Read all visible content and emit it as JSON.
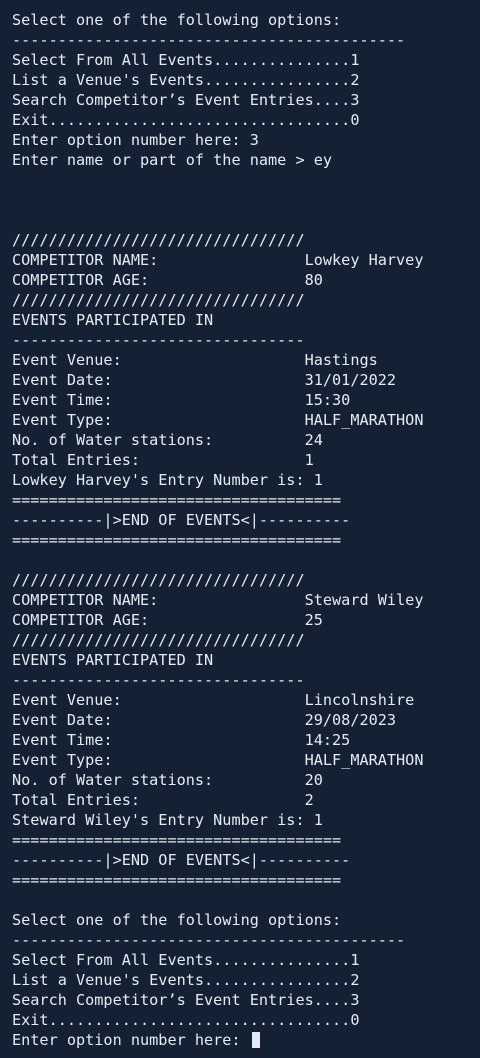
{
  "terminal": {
    "background": "#142033",
    "foreground": "#e6ebf2",
    "lines": [
      "Select one of the following options:",
      "-------------------------------------------",
      "Select From All Events...............1",
      "List a Venue's Events................2",
      "Search Competitor’s Event Entries....3",
      "Exit.................................0",
      "Enter option number here: 3",
      "Enter name or part of the name > ey",
      "",
      "",
      "",
      "////////////////////////////////",
      "COMPETITOR NAME:                Lowkey Harvey",
      "COMPETITOR AGE:                 80",
      "////////////////////////////////",
      "EVENTS PARTICIPATED IN",
      "--------------------------------",
      "Event Venue:                    Hastings",
      "Event Date:                     31/01/2022",
      "Event Time:                     15:30",
      "Event Type:                     HALF_MARATHON",
      "No. of Water stations:          24",
      "Total Entries:                  1",
      "Lowkey Harvey's Entry Number is: 1",
      "====================================",
      "----------|>END OF EVENTS<|----------",
      "====================================",
      "",
      "////////////////////////////////",
      "COMPETITOR NAME:                Steward Wiley",
      "COMPETITOR AGE:                 25",
      "////////////////////////////////",
      "EVENTS PARTICIPATED IN",
      "--------------------------------",
      "Event Venue:                    Lincolnshire",
      "Event Date:                     29/08/2023",
      "Event Time:                     14:25",
      "Event Type:                     HALF_MARATHON",
      "No. of Water stations:          20",
      "Total Entries:                  2",
      "Steward Wiley's Entry Number is: 1",
      "====================================",
      "----------|>END OF EVENTS<|----------",
      "====================================",
      "",
      "Select one of the following options:",
      "-------------------------------------------",
      "Select From All Events...............1",
      "List a Venue's Events................2",
      "Search Competitor’s Event Entries....3",
      "Exit.................................0",
      "Enter option number here: "
    ]
  }
}
